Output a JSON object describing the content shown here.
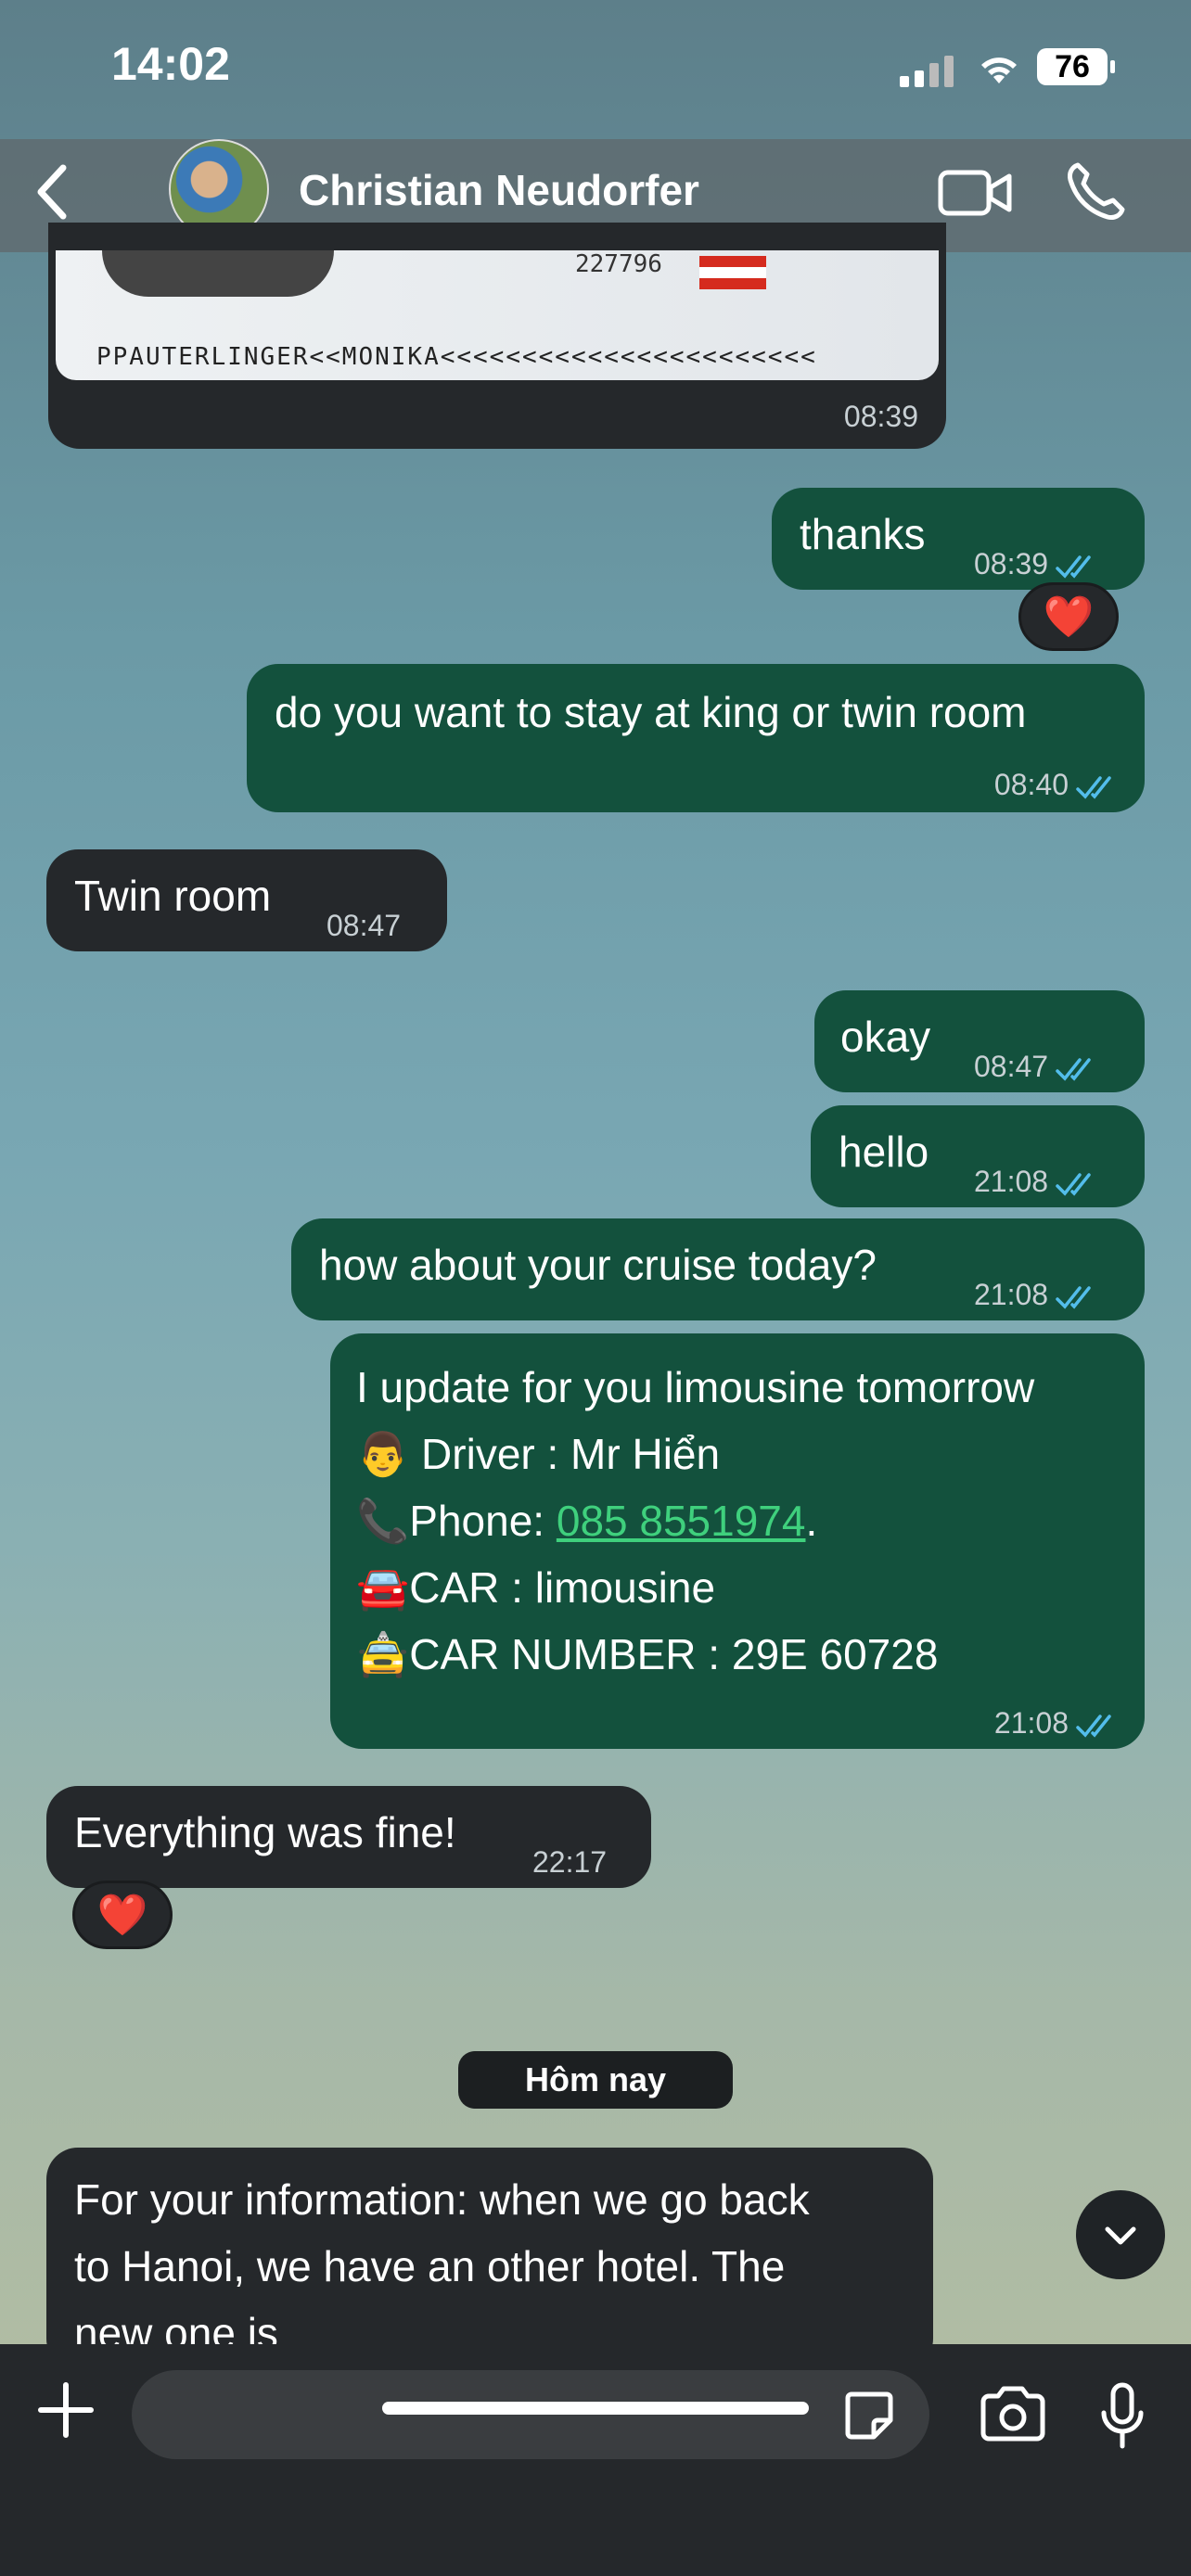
{
  "status_bar": {
    "time": "14:02",
    "battery": "76"
  },
  "header": {
    "contact_name": "Christian Neudorfer"
  },
  "passport": {
    "number": "227796",
    "mrz": "PPAUTERLINGER<<MONIKA<<<<<<<<<<<<<<<<<<<<<<<",
    "time": "08:39"
  },
  "messages": [
    {
      "dir": "out",
      "text": "thanks",
      "time": "08:39",
      "reaction": "❤️"
    },
    {
      "dir": "out",
      "text": "do you want to stay at king or twin room",
      "time": "08:40"
    },
    {
      "dir": "in",
      "text": "Twin room",
      "time": "08:47"
    },
    {
      "dir": "out",
      "text": "okay",
      "time": "08:47"
    },
    {
      "dir": "out",
      "text": "hello",
      "time": "21:08"
    },
    {
      "dir": "out",
      "text": "how about your cruise today?",
      "time": "21:08"
    },
    {
      "dir": "out",
      "lines": [
        "I update for you limousine tomorrow",
        "👨 Driver : Mr Hiển",
        "📞Phone: ",
        "🚘CAR :  limousine",
        "🚖CAR NUMBER : 29E 60728"
      ],
      "phone_link": "085 8551974",
      "phone_suffix": ".",
      "time": "21:08"
    },
    {
      "dir": "in",
      "text": "Everything was fine!",
      "time": "22:17",
      "reaction": "❤️"
    },
    {
      "dir": "in",
      "lines": [
        "For your information: when we go back",
        "to Hanoi, we have an other hotel. The",
        "new one is"
      ]
    }
  ],
  "day_label": "Hôm nay",
  "composer": {
    "placeholder": ""
  },
  "colors": {
    "outgoing": "#13513d",
    "incoming": "#25282b",
    "tick": "#53bdeb"
  }
}
